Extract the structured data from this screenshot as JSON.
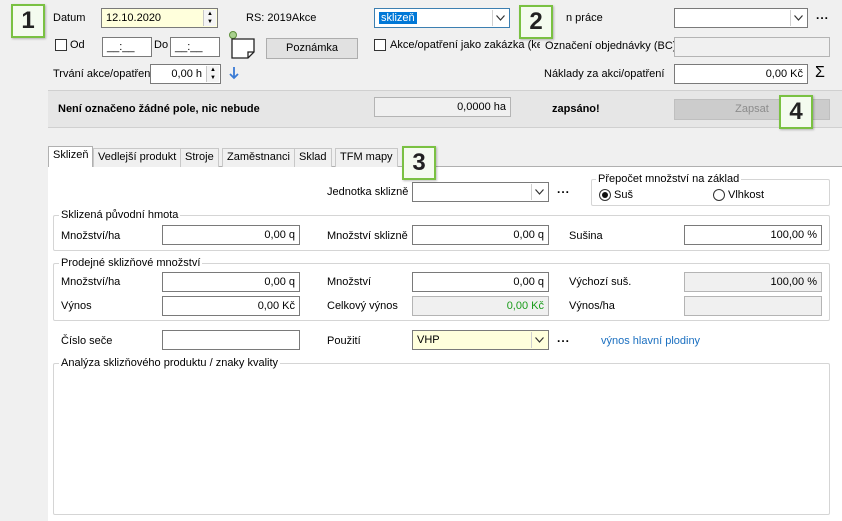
{
  "callouts": [
    "1",
    "2",
    "3",
    "4"
  ],
  "header": {
    "datum_label": "Datum",
    "datum_value": "12.10.2020",
    "rs_label": "RS: 2019Akce",
    "operation_value": "sklizeň",
    "sled_prace_label": "n práce",
    "od_label": "Od",
    "od_value": "__:__",
    "do_label": "Do",
    "do_value": "__:__",
    "poznamka_label": "Poznámka",
    "zakazka_label": "Akce/opatření jako zakázka (ke",
    "objednavka_label": "Označení objednávky (BC)",
    "trvani_label": "Trvání akce/opatření",
    "trvani_value": "0,00 h",
    "naklady_label": "Náklady za akci/opatření",
    "naklady_value": "0,00 Kč",
    "status_text": "Není označeno žádné pole, nic nebude",
    "area_value": "0,0000 ha",
    "status_suffix": "zapsáno!",
    "zapsat_label": "Zapsat"
  },
  "tabs": [
    {
      "label": "Sklizeň"
    },
    {
      "label": "Vedlejší produkt"
    },
    {
      "label": "Stroje"
    },
    {
      "label": "Zaměstnanci"
    },
    {
      "label": "Sklad"
    },
    {
      "label": "TFM mapy"
    }
  ],
  "sklizen": {
    "jednotka_label": "Jednotka sklizně",
    "jednotka_value": "",
    "prepocet_title": "Přepočet množství na základ",
    "prepocet_options": [
      "Suš",
      "Vlhkost"
    ],
    "puvodni_title": "Sklizená původní hmota",
    "puvodni_mnozstvi_ha_label": "Množství/ha",
    "puvodni_mnozstvi_ha_value": "0,00 q",
    "puvodni_mnozstvi_label": "Množství sklizně",
    "puvodni_mnozstvi_value": "0,00 q",
    "susina_label": "Sušina",
    "susina_value": "100,00 %",
    "prodejne_title": "Prodejné sklizňové množství",
    "prodejne_mnozstvi_ha_label": "Množství/ha",
    "prodejne_mnozstvi_ha_value": "0,00 q",
    "prodejne_mnozstvi_label": "Množství",
    "prodejne_mnozstvi_value": "0,00 q",
    "vychozi_sus_label": "Výchozí suš.",
    "vychozi_sus_value": "100,00 %",
    "vynos_label": "Výnos",
    "vynos_value": "0,00 Kč",
    "celkovy_vynos_label": "Celkový výnos",
    "celkovy_vynos_value": "0,00 Kč",
    "vynos_ha_label": "Výnos/ha",
    "vynos_ha_value": "",
    "cislo_sece_label": "Číslo seče",
    "cislo_sece_value": "",
    "pouziti_label": "Použití",
    "pouziti_value": "VHP",
    "vynos_link": "výnos hlavní plodiny",
    "analyza_title": "Analýza sklizňového produktu / znaky kvality"
  }
}
